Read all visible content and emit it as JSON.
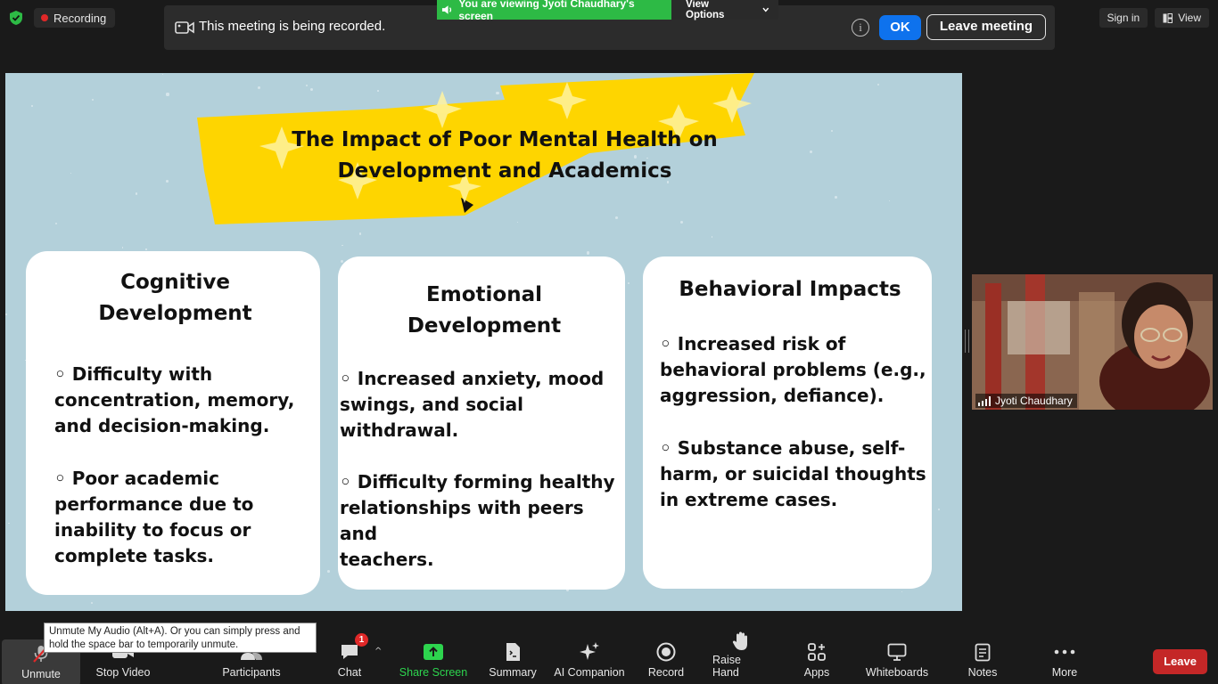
{
  "recording": {
    "label": "Recording"
  },
  "notice": {
    "message": "This meeting is being recorded.",
    "ok_label": "OK",
    "leave_label": "Leave meeting"
  },
  "viewing": {
    "banner": "You are viewing Jyoti Chaudhary's screen",
    "options_label": "View Options"
  },
  "top_right": {
    "sign_in": "Sign in",
    "view": "View"
  },
  "slide": {
    "title_line1": "The Impact of Poor Mental Health on",
    "title_line2": "Development and Academics",
    "cards": [
      {
        "heading_line1": "Cognitive",
        "heading_line2": "Development",
        "bullets": [
          [
            "◦ Difficulty with",
            "concentration, memory,",
            "and decision-making."
          ],
          [
            "◦ Poor academic",
            "performance due to",
            "inability to focus or",
            "complete tasks."
          ]
        ]
      },
      {
        "heading_line1": "Emotional",
        "heading_line2": "Development",
        "bullets": [
          [
            "◦ Increased anxiety, mood",
            "swings, and social withdrawal."
          ],
          [
            "◦ Difficulty forming healthy",
            "relationships with peers and",
            "teachers."
          ]
        ]
      },
      {
        "heading_line1": "Behavioral Impacts",
        "heading_line2": "",
        "bullets": [
          [
            "◦ Increased risk of",
            "behavioral problems (e.g.,",
            "aggression, defiance)."
          ],
          [
            "◦ Substance abuse, self-",
            "harm, or suicidal thoughts",
            "in extreme cases."
          ]
        ]
      }
    ]
  },
  "participant": {
    "name": "Jyoti Chaudhary"
  },
  "tooltip": {
    "line1": "Unmute My Audio (Alt+A). Or you can simply press and",
    "line2": "hold the space bar to temporarily unmute."
  },
  "toolbar": {
    "unmute": "Unmute",
    "stop_video": "Stop Video",
    "participants": "Participants",
    "chat": "Chat",
    "chat_badge": "1",
    "share_screen": "Share Screen",
    "summary": "Summary",
    "ai_companion": "AI Companion",
    "record": "Record",
    "raise_hand": "Raise Hand",
    "apps": "Apps",
    "whiteboards": "Whiteboards",
    "notes": "Notes",
    "more": "More",
    "leave": "Leave"
  },
  "colors": {
    "share_green": "#2dd44e",
    "zoom_blue": "#0e72ed",
    "leave_red": "#c42727",
    "slide_bg": "#b3d0da",
    "banner_yellow": "#fed500"
  }
}
